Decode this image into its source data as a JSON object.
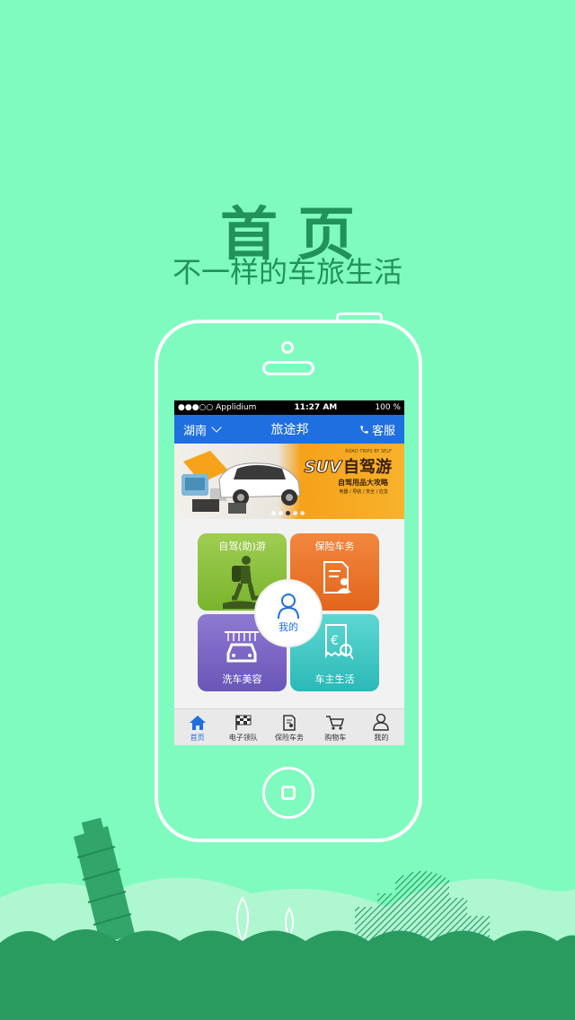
{
  "hero": {
    "title": "首页",
    "subtitle": "不一样的车旅生活"
  },
  "status_bar": {
    "carrier": "●●●○○ Applidium",
    "time": "11:27 AM",
    "battery": "100 %"
  },
  "nav": {
    "region": "湖南",
    "title": "旅途邦",
    "service": "客服"
  },
  "banner": {
    "tagline": "ROAD TRIPS BY SELF",
    "headline_suv": "SUV",
    "headline": "自驾游",
    "line2": "自驾用品大攻略",
    "line3": "电器 / 导航 / 安全 / 应急",
    "page_count": 5,
    "active_page": 3
  },
  "tiles": [
    {
      "label": "自驾(助)游",
      "icon": "hiker-icon"
    },
    {
      "label": "保险车务",
      "icon": "document-person-icon"
    },
    {
      "label": "洗车美容",
      "icon": "car-wash-icon"
    },
    {
      "label": "车主生活",
      "icon": "receipt-euro-icon"
    }
  ],
  "center_button": {
    "label": "我的"
  },
  "tabs": [
    {
      "label": "首页",
      "icon": "home-icon",
      "active": true
    },
    {
      "label": "电子领队",
      "icon": "checkered-flag-icon",
      "active": false
    },
    {
      "label": "保险车务",
      "icon": "document-icon",
      "active": false
    },
    {
      "label": "购物车",
      "icon": "cart-icon",
      "active": false
    },
    {
      "label": "我的",
      "icon": "user-icon",
      "active": false
    }
  ],
  "colors": {
    "background": "#7ffbbf",
    "accent_green": "#22925b",
    "nav_blue": "#1f6fe0"
  }
}
